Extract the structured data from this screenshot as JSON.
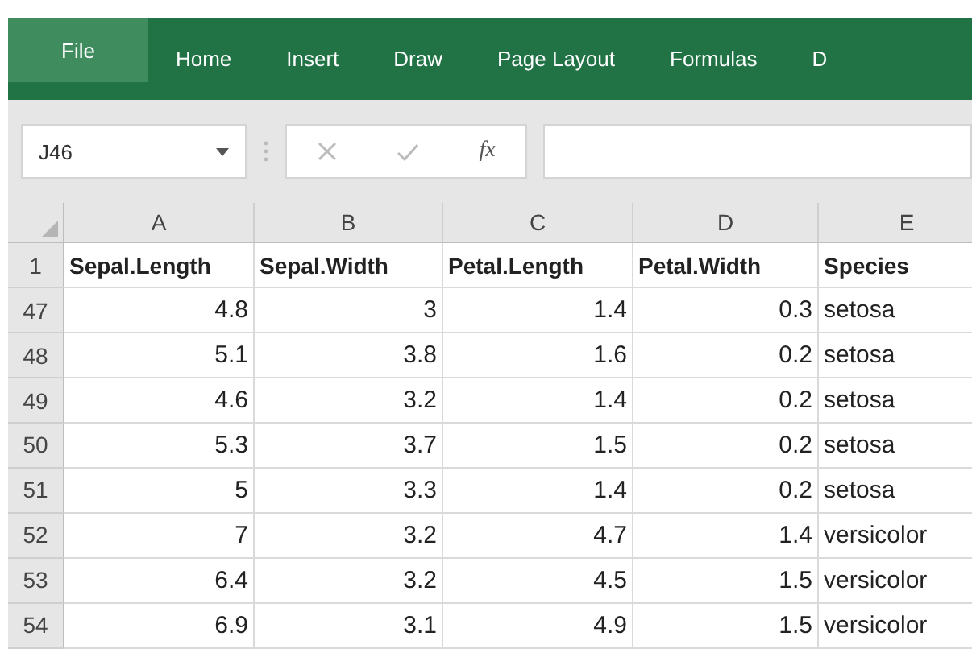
{
  "ribbon_tabs": [
    {
      "label": "File",
      "selected": true
    },
    {
      "label": "Home",
      "selected": false
    },
    {
      "label": "Insert",
      "selected": false
    },
    {
      "label": "Draw",
      "selected": false
    },
    {
      "label": "Page Layout",
      "selected": false
    },
    {
      "label": "Formulas",
      "selected": false
    },
    {
      "label": "D",
      "selected": false
    }
  ],
  "name_box": {
    "value": "J46"
  },
  "formula_bar": {
    "function_label": "fx"
  },
  "sheet": {
    "columns": [
      "A",
      "B",
      "C",
      "D",
      "E"
    ],
    "rows": [
      {
        "number": "1",
        "kind": "header",
        "cells": [
          "Sepal.Length",
          "Sepal.Width",
          "Petal.Length",
          "Petal.Width",
          "Species"
        ]
      },
      {
        "number": "47",
        "kind": "data",
        "cells": [
          "4.8",
          "3",
          "1.4",
          "0.3",
          "setosa"
        ]
      },
      {
        "number": "48",
        "kind": "data",
        "cells": [
          "5.1",
          "3.8",
          "1.6",
          "0.2",
          "setosa"
        ]
      },
      {
        "number": "49",
        "kind": "data",
        "cells": [
          "4.6",
          "3.2",
          "1.4",
          "0.2",
          "setosa"
        ]
      },
      {
        "number": "50",
        "kind": "data",
        "cells": [
          "5.3",
          "3.7",
          "1.5",
          "0.2",
          "setosa"
        ]
      },
      {
        "number": "51",
        "kind": "data",
        "cells": [
          "5",
          "3.3",
          "1.4",
          "0.2",
          "setosa"
        ]
      },
      {
        "number": "52",
        "kind": "data",
        "cells": [
          "7",
          "3.2",
          "4.7",
          "1.4",
          "versicolor"
        ]
      },
      {
        "number": "53",
        "kind": "data",
        "cells": [
          "6.4",
          "3.2",
          "4.5",
          "1.5",
          "versicolor"
        ]
      },
      {
        "number": "54",
        "kind": "data",
        "cells": [
          "6.9",
          "3.1",
          "4.9",
          "1.5",
          "versicolor"
        ]
      }
    ]
  }
}
